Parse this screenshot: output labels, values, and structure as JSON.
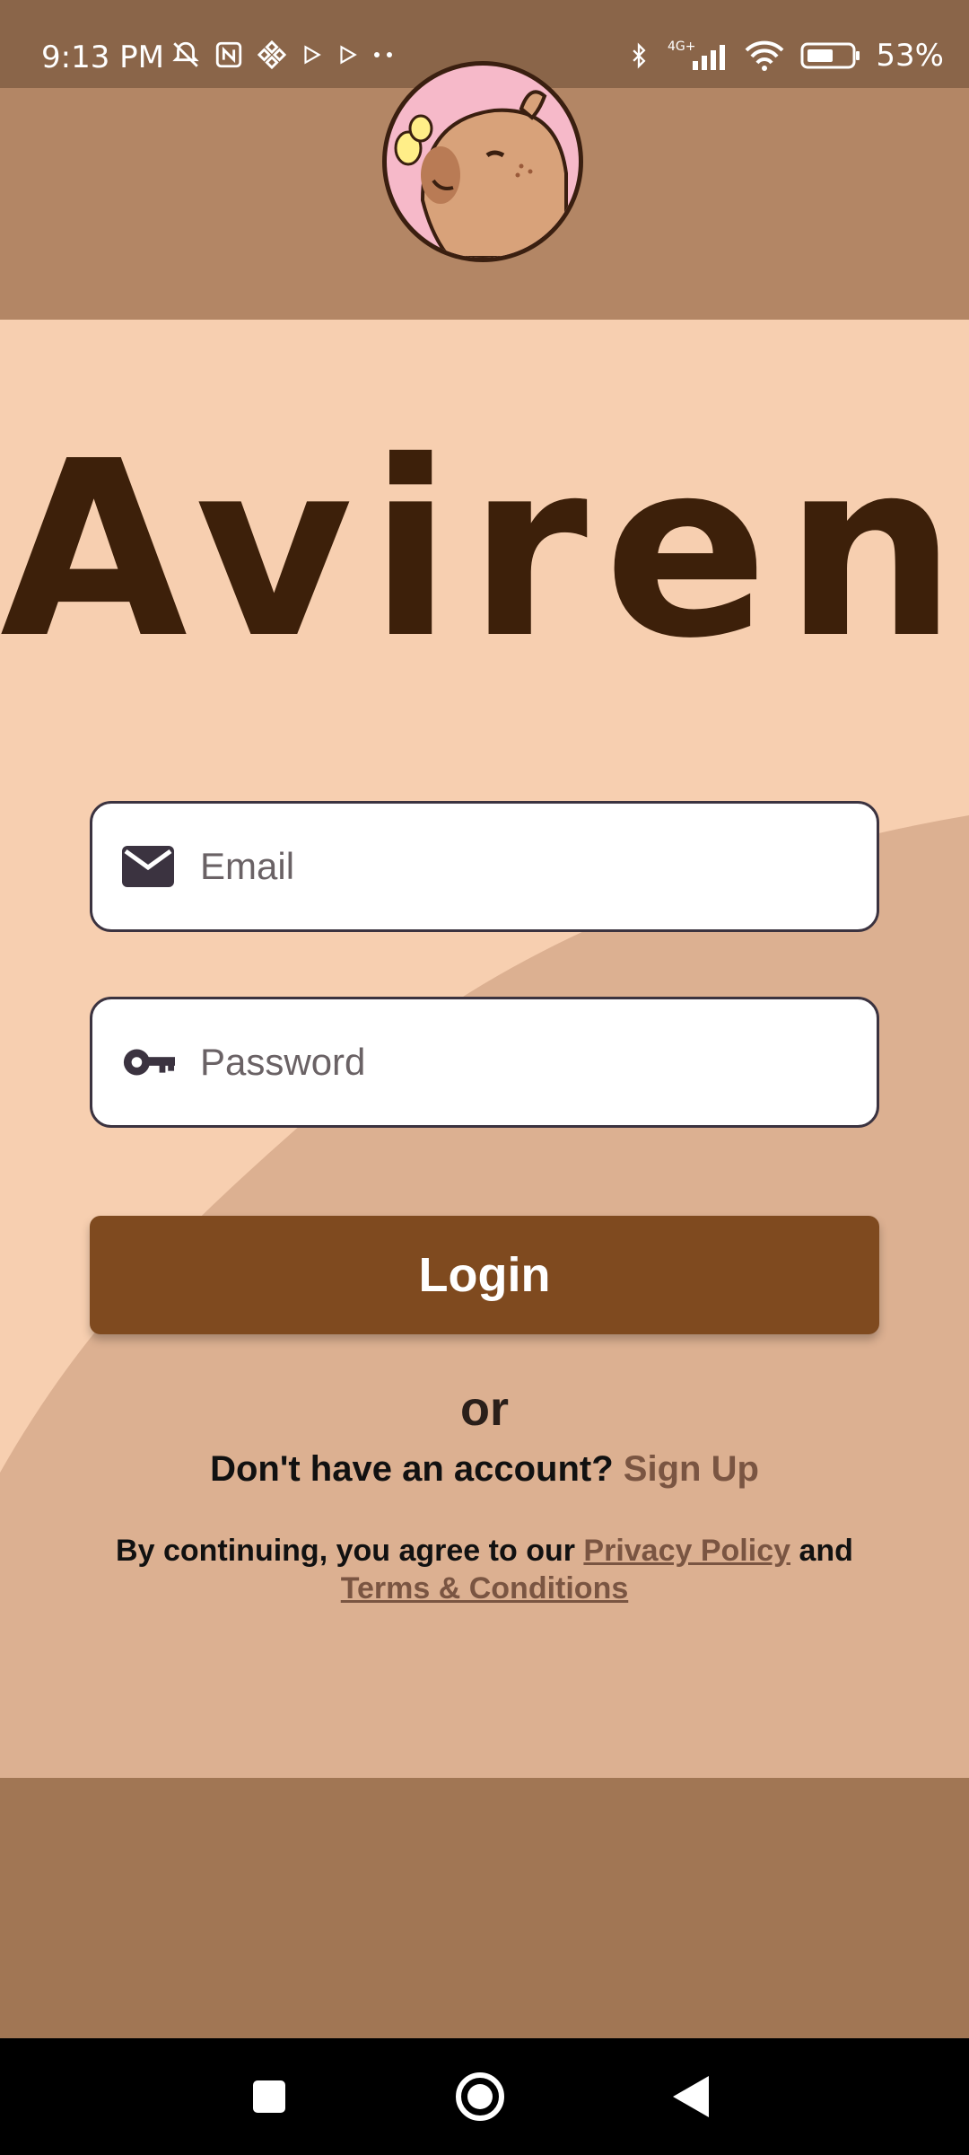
{
  "status_bar": {
    "time": "9:13 PM",
    "battery_percent": "53%",
    "network": "4G+"
  },
  "app": {
    "title": "Aviren"
  },
  "login_form": {
    "email_placeholder": "Email",
    "password_placeholder": "Password",
    "login_label": "Login"
  },
  "alt_auth": {
    "or_text": "or",
    "no_account_text": "Don't have an account?",
    "signup_label": "Sign Up"
  },
  "legal": {
    "prefix": "By continuing, you agree to our",
    "privacy_label": "Privacy Policy",
    "and_text": "and",
    "terms_label": "Terms & Conditions"
  },
  "colors": {
    "primary_button": "#7f4a1f",
    "accent_link": "#7a5542",
    "background": "#f7cfb0",
    "header": "#b38665",
    "status_bar": "#8a6549",
    "footer": "#a17654",
    "title_text": "#3d200a"
  },
  "icons": {
    "email": "mail-icon",
    "password": "key-icon",
    "avatar": "capybara-avatar-icon"
  }
}
